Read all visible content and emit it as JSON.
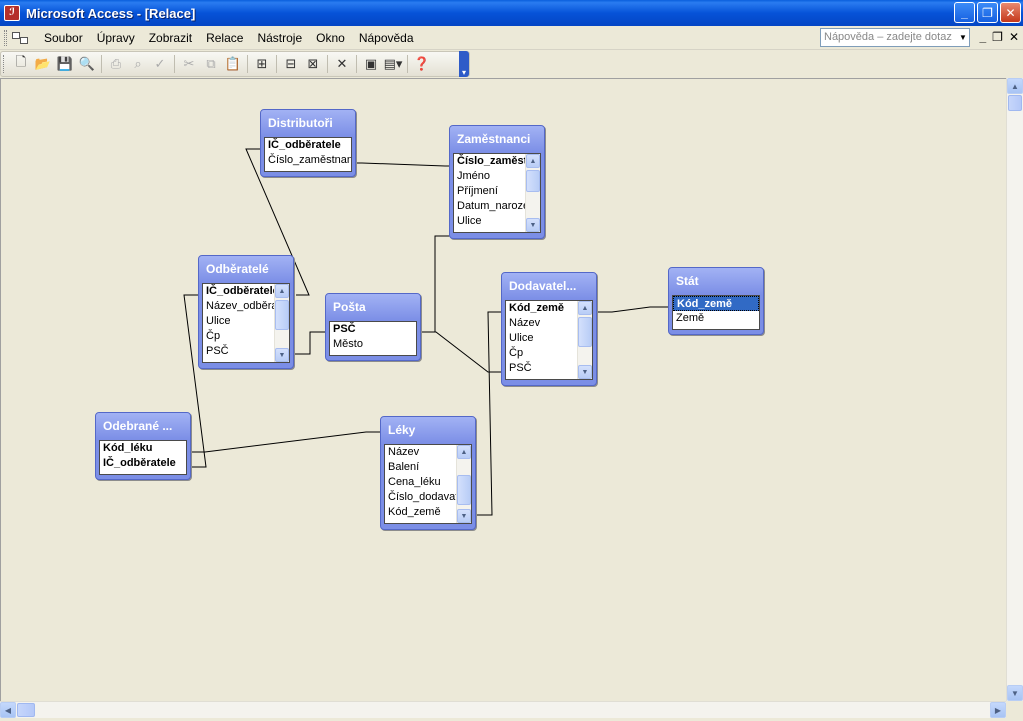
{
  "window": {
    "title": "Microsoft Access - [Relace]",
    "app_icon": "access-icon"
  },
  "menu": {
    "items": [
      {
        "label": "Soubor"
      },
      {
        "label": "Úpravy"
      },
      {
        "label": "Zobrazit"
      },
      {
        "label": "Relace"
      },
      {
        "label": "Nástroje"
      },
      {
        "label": "Okno"
      },
      {
        "label": "Nápověda"
      }
    ],
    "help_placeholder": "Nápověda – zadejte dotaz"
  },
  "tables": {
    "distributori": {
      "title": "Distributoři",
      "fields": [
        "IČ_odběratele",
        "Číslo_zaměstnance"
      ]
    },
    "zamestnanci": {
      "title": "Zaměstnanci",
      "fields": [
        "Číslo_zaměstnance",
        "Jméno",
        "Příjmení",
        "Datum_narození",
        "Ulice"
      ]
    },
    "odberatele": {
      "title": "Odběratelé",
      "fields": [
        "IČ_odběratele",
        "Název_odběratele",
        "Ulice",
        "Čp",
        "PSČ"
      ]
    },
    "posta": {
      "title": "Pošta",
      "fields": [
        "PSČ",
        "Město"
      ]
    },
    "dodavatele": {
      "title": "Dodavatel...",
      "fields": [
        "Kód_země",
        "Název",
        "Ulice",
        "Čp",
        "PSČ"
      ]
    },
    "stat": {
      "title": "Stát",
      "fields": [
        "Kód_země",
        "Země"
      ]
    },
    "odebrane": {
      "title": "Odebrané ...",
      "fields": [
        "Kód_léku",
        "IČ_odběratele"
      ]
    },
    "leky": {
      "title": "Léky",
      "fields": [
        "Název",
        "Balení",
        "Cena_léku",
        "Číslo_dodavatele",
        "Kód_země"
      ]
    }
  },
  "colors": {
    "titlebar": "#0653d8",
    "table_frame": "#7b8ee6",
    "selection": "#316ac5",
    "workspace": "#ece9d8"
  }
}
